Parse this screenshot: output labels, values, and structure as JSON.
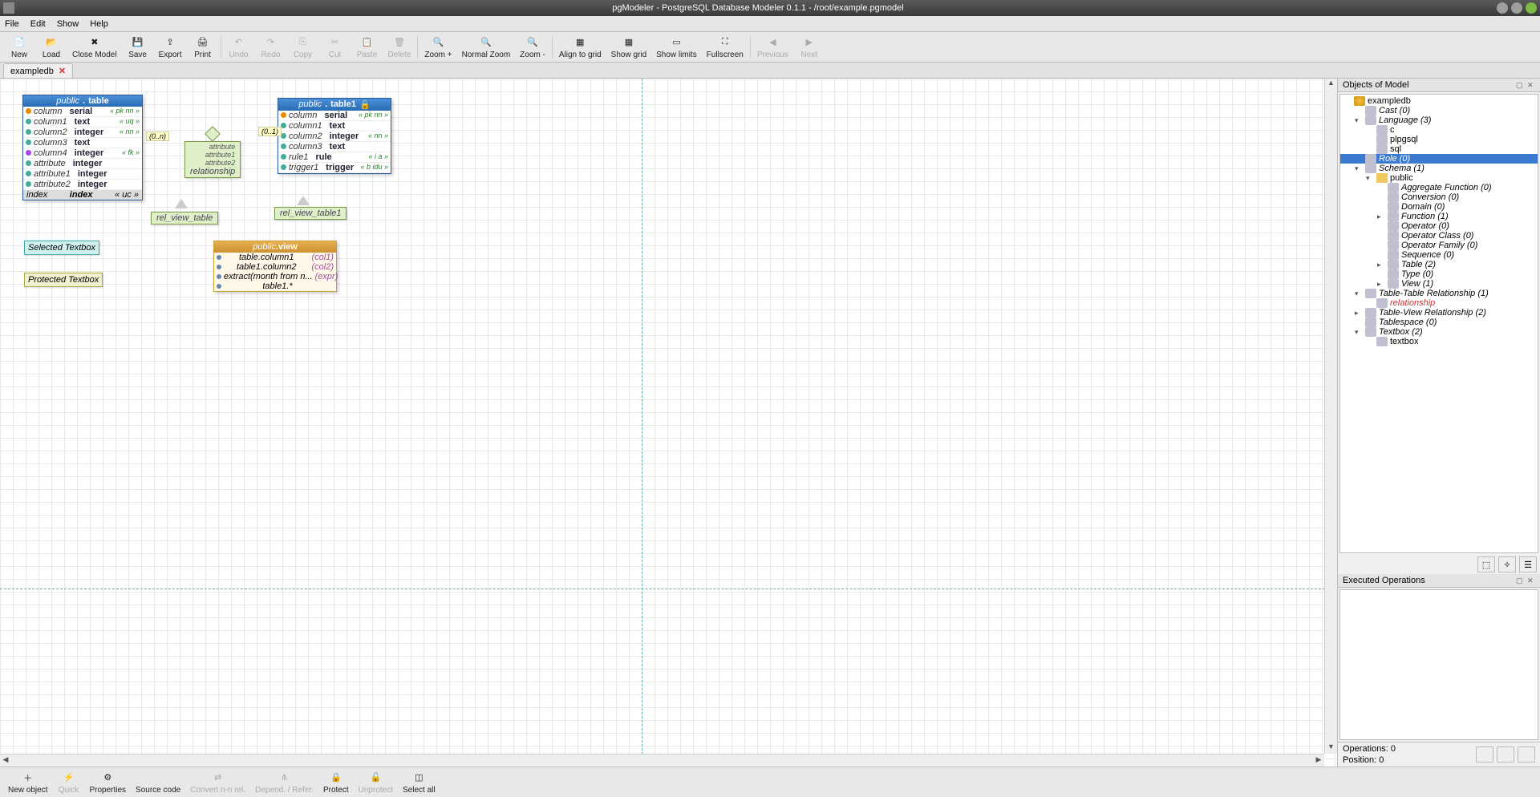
{
  "titlebar": {
    "text": "pgModeler - PostgreSQL Database Modeler 0.1.1 - /root/example.pgmodel"
  },
  "menu": {
    "file": "File",
    "edit": "Edit",
    "show": "Show",
    "help": "Help"
  },
  "toolbar": [
    {
      "id": "new",
      "label": "New",
      "enabled": true
    },
    {
      "id": "load",
      "label": "Load",
      "enabled": true
    },
    {
      "id": "close",
      "label": "Close Model",
      "enabled": true
    },
    {
      "id": "save",
      "label": "Save",
      "enabled": true
    },
    {
      "id": "export",
      "label": "Export",
      "enabled": true
    },
    {
      "id": "print",
      "label": "Print",
      "enabled": true
    },
    {
      "id": "undo",
      "label": "Undo",
      "enabled": false
    },
    {
      "id": "redo",
      "label": "Redo",
      "enabled": false
    },
    {
      "id": "copy",
      "label": "Copy",
      "enabled": false
    },
    {
      "id": "cut",
      "label": "Cut",
      "enabled": false
    },
    {
      "id": "paste",
      "label": "Paste",
      "enabled": false
    },
    {
      "id": "delete",
      "label": "Delete",
      "enabled": false
    },
    {
      "id": "zoomin",
      "label": "Zoom +",
      "enabled": true
    },
    {
      "id": "normalzoom",
      "label": "Normal Zoom",
      "enabled": true
    },
    {
      "id": "zoomout",
      "label": "Zoom -",
      "enabled": true
    },
    {
      "id": "align",
      "label": "Align to grid",
      "enabled": true
    },
    {
      "id": "showgrid",
      "label": "Show grid",
      "enabled": true
    },
    {
      "id": "showlimits",
      "label": "Show limits",
      "enabled": true
    },
    {
      "id": "fullscreen",
      "label": "Fullscreen",
      "enabled": true
    },
    {
      "id": "previous",
      "label": "Previous",
      "enabled": false
    },
    {
      "id": "next",
      "label": "Next",
      "enabled": false
    }
  ],
  "tab": {
    "name": "exampledb"
  },
  "table": {
    "schema": "public",
    "name": "table",
    "rows": [
      {
        "dot": "pk",
        "name": "column",
        "type": "serial",
        "tag": "« pk nn »"
      },
      {
        "dot": "",
        "name": "column1",
        "type": "text",
        "tag": "« uq »"
      },
      {
        "dot": "",
        "name": "column2",
        "type": "integer",
        "tag": "« nn »"
      },
      {
        "dot": "",
        "name": "column3",
        "type": "text",
        "tag": ""
      },
      {
        "dot": "fk",
        "name": "column4",
        "type": "integer",
        "tag": "« fk »"
      },
      {
        "dot": "",
        "name": "attribute",
        "type": "integer",
        "tag": ""
      },
      {
        "dot": "",
        "name": "attribute1",
        "type": "integer",
        "tag": ""
      },
      {
        "dot": "",
        "name": "attribute2",
        "type": "integer",
        "tag": ""
      }
    ],
    "footL": "index",
    "footR": "index",
    "footTag": "« uc »"
  },
  "table1": {
    "schema": "public",
    "name": "table1",
    "rows": [
      {
        "dot": "pk",
        "name": "column",
        "type": "serial",
        "tag": "« pk nn »"
      },
      {
        "dot": "",
        "name": "column1",
        "type": "text",
        "tag": ""
      },
      {
        "dot": "",
        "name": "column2",
        "type": "integer",
        "tag": "« nn »"
      },
      {
        "dot": "",
        "name": "column3",
        "type": "text",
        "tag": ""
      },
      {
        "dot": "",
        "name": "rule1",
        "type": "rule",
        "tag": "« i a »"
      },
      {
        "dot": "",
        "name": "trigger1",
        "type": "trigger",
        "tag": "« b idu »"
      }
    ]
  },
  "rel": {
    "name": "relationship",
    "attrs": [
      "attribute",
      "attribute1",
      "attribute2"
    ],
    "cardL": "(0..n)",
    "cardR": "(0..1)"
  },
  "relview1": "rel_view_table",
  "relview2": "rel_view_table1",
  "view": {
    "schema": "public",
    "name": "view",
    "rows": [
      {
        "lbl": "table.column1",
        "ref": "(col1)"
      },
      {
        "lbl": "table1.column2",
        "ref": "(col2)"
      },
      {
        "lbl": "extract(month from n...",
        "ref": "(expr)"
      },
      {
        "lbl": "table1.*",
        "ref": ""
      }
    ]
  },
  "textbox1": "Selected Textbox",
  "textbox2": "Protected Textbox",
  "objpane": {
    "title": "Objects of Model",
    "tree": [
      {
        "depth": 0,
        "exp": "",
        "ico": "db",
        "label": "exampledb",
        "italic": false
      },
      {
        "depth": 1,
        "exp": "",
        "ico": "g",
        "label": "Cast (0)",
        "italic": true
      },
      {
        "depth": 1,
        "exp": "▾",
        "ico": "g",
        "label": "Language (3)",
        "italic": true
      },
      {
        "depth": 2,
        "exp": "",
        "ico": "g",
        "label": "c",
        "italic": false
      },
      {
        "depth": 2,
        "exp": "",
        "ico": "g",
        "label": "plpgsql",
        "italic": false
      },
      {
        "depth": 2,
        "exp": "",
        "ico": "g",
        "label": "sql",
        "italic": false
      },
      {
        "depth": 1,
        "exp": "",
        "ico": "g",
        "label": "Role (0)",
        "italic": true,
        "selected": true
      },
      {
        "depth": 1,
        "exp": "▾",
        "ico": "g",
        "label": "Schema (1)",
        "italic": true
      },
      {
        "depth": 2,
        "exp": "▾",
        "ico": "f",
        "label": "public",
        "italic": false
      },
      {
        "depth": 3,
        "exp": "",
        "ico": "g",
        "label": "Aggregate Function (0)",
        "italic": true
      },
      {
        "depth": 3,
        "exp": "",
        "ico": "g",
        "label": "Conversion (0)",
        "italic": true
      },
      {
        "depth": 3,
        "exp": "",
        "ico": "g",
        "label": "Domain (0)",
        "italic": true
      },
      {
        "depth": 3,
        "exp": "▸",
        "ico": "g",
        "label": "Function (1)",
        "italic": true
      },
      {
        "depth": 3,
        "exp": "",
        "ico": "g",
        "label": "Operator (0)",
        "italic": true
      },
      {
        "depth": 3,
        "exp": "",
        "ico": "g",
        "label": "Operator Class (0)",
        "italic": true
      },
      {
        "depth": 3,
        "exp": "",
        "ico": "g",
        "label": "Operator Family (0)",
        "italic": true
      },
      {
        "depth": 3,
        "exp": "",
        "ico": "g",
        "label": "Sequence (0)",
        "italic": true
      },
      {
        "depth": 3,
        "exp": "▸",
        "ico": "g",
        "label": "Table (2)",
        "italic": true
      },
      {
        "depth": 3,
        "exp": "",
        "ico": "g",
        "label": "Type (0)",
        "italic": true
      },
      {
        "depth": 3,
        "exp": "▸",
        "ico": "g",
        "label": "View (1)",
        "italic": true
      },
      {
        "depth": 1,
        "exp": "▾",
        "ico": "g",
        "label": "Table-Table Relationship (1)",
        "italic": true
      },
      {
        "depth": 2,
        "exp": "",
        "ico": "g",
        "label": "relationship",
        "italic": true,
        "red": true
      },
      {
        "depth": 1,
        "exp": "▸",
        "ico": "g",
        "label": "Table-View Relationship (2)",
        "italic": true
      },
      {
        "depth": 1,
        "exp": "",
        "ico": "g",
        "label": "Tablespace (0)",
        "italic": true
      },
      {
        "depth": 1,
        "exp": "▾",
        "ico": "g",
        "label": "Textbox (2)",
        "italic": true
      },
      {
        "depth": 2,
        "exp": "",
        "ico": "g",
        "label": "textbox",
        "italic": false
      }
    ]
  },
  "execpane": {
    "title": "Executed Operations"
  },
  "status": {
    "ops": "Operations: 0",
    "pos": "Position:      0"
  },
  "bottombar": [
    {
      "id": "newobj",
      "label": "New object",
      "enabled": true
    },
    {
      "id": "quick",
      "label": "Quick",
      "enabled": false
    },
    {
      "id": "properties",
      "label": "Properties",
      "enabled": true
    },
    {
      "id": "source",
      "label": "Source code",
      "enabled": true
    },
    {
      "id": "convert",
      "label": "Convert n-n rel.",
      "enabled": false
    },
    {
      "id": "depend",
      "label": "Depend. / Refer.",
      "enabled": false
    },
    {
      "id": "protect",
      "label": "Protect",
      "enabled": true
    },
    {
      "id": "unprotect",
      "label": "Unprotect",
      "enabled": false
    },
    {
      "id": "selectall",
      "label": "Select all",
      "enabled": true
    }
  ]
}
